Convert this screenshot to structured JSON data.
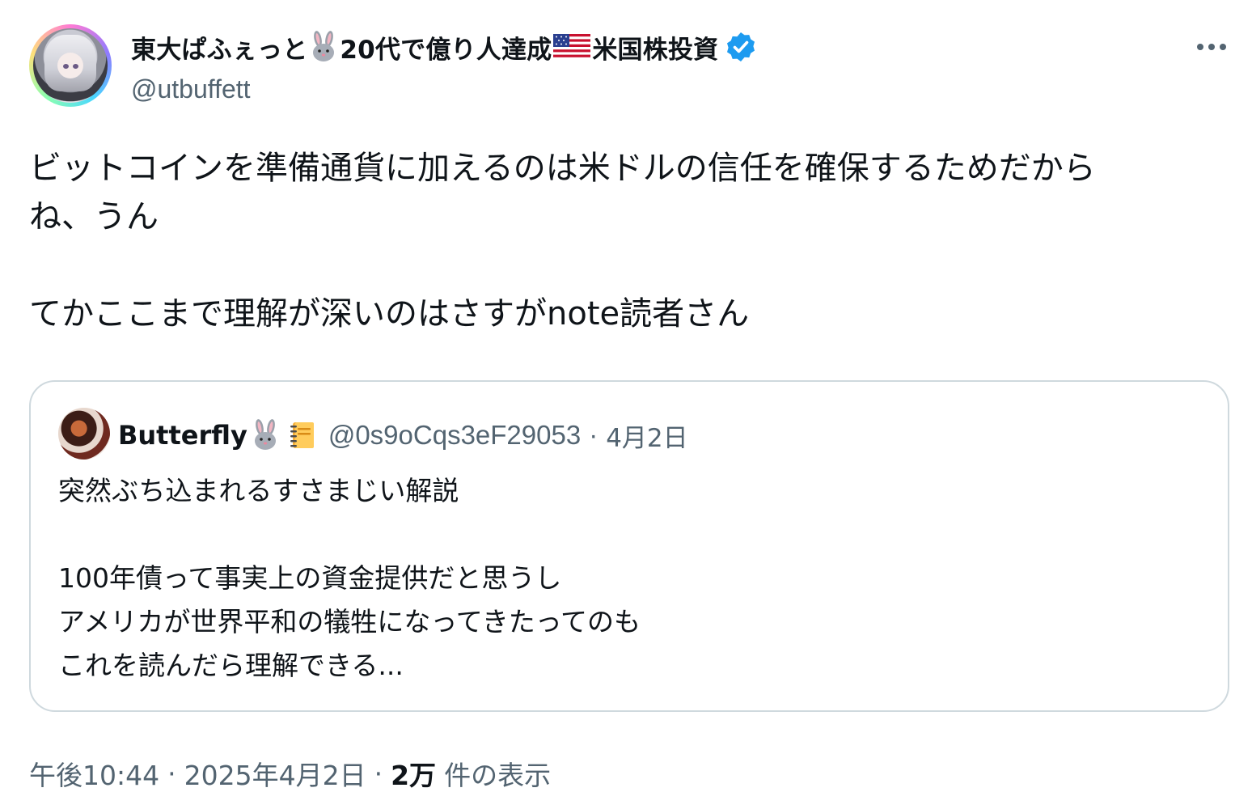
{
  "author": {
    "name_parts": [
      "東大ぱふぇっと",
      "20代で億り人達成",
      "米国株投資"
    ],
    "handle": "@utbuffett",
    "verified": true,
    "emoji": [
      "rabbit-icon",
      "us-flag-icon",
      "verified-badge-icon"
    ],
    "badge_color": "#1d9bf0"
  },
  "tweet": {
    "text": "ビットコインを準備通貨に加えるのは米ドルの信任を確保するためだから\nね、うん\n\nてかここまで理解が深いのはさすがnote読者さん"
  },
  "quoted": {
    "name": "Butterfly",
    "handle": "@0s9oCqs3eF29053",
    "separator": "·",
    "date": "4月2日",
    "text": "突然ぶち込まれるすさまじい解説\n\n100年債って事実上の資金提供だと思うし\nアメリカが世界平和の犠牲になってきたってのも\nこれを読んだら理解できる...",
    "emoji": [
      "rabbit-icon",
      "notebook-icon"
    ]
  },
  "meta": {
    "time": "午後10:44",
    "date": "2025年4月2日",
    "separator": "·",
    "views_count": "2万",
    "views_label": "件の表示"
  },
  "colors": {
    "text": "#0f1419",
    "secondary": "#536471",
    "border": "#cfd9de",
    "accent": "#1d9bf0"
  }
}
